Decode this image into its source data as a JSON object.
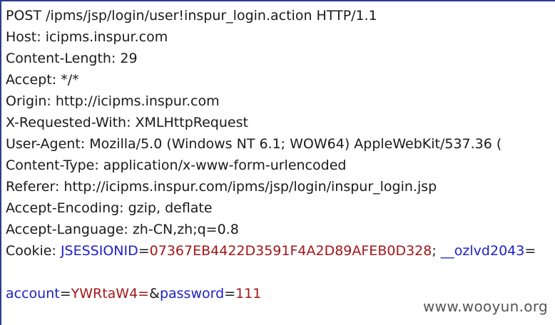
{
  "request": {
    "request_line": "POST /ipms/jsp/login/user!inspur_login.action HTTP/1.1",
    "headers": [
      "Host: icipms.inspur.com",
      "Content-Length: 29",
      "Accept: */*",
      "Origin: http://icipms.inspur.com",
      "X-Requested-With: XMLHttpRequest",
      "User-Agent: Mozilla/5.0 (Windows NT 6.1; WOW64) AppleWebKit/537.36 (",
      "Content-Type: application/x-www-form-urlencoded",
      "Referer: http://icipms.inspur.com/ipms/jsp/login/inspur_login.jsp",
      "Accept-Encoding: gzip, deflate",
      "Accept-Language: zh-CN,zh;q=0.8"
    ],
    "cookie": {
      "label": "Cookie: ",
      "name1": "JSESSIONID",
      "eq": "=",
      "value1": "07367EB4422D3591F4A2D89AFEB0D328",
      "sep": "; ",
      "name2": "__ozlvd2043",
      "tail": "="
    },
    "body": {
      "key1": "account",
      "eq": "=",
      "val1": "YWRtaW4=",
      "amp": "&",
      "key2": "password",
      "val2": "111"
    }
  },
  "watermark": "www.wooyun.org",
  "colors": {
    "key": "#1d20c8",
    "value": "#a3161a",
    "text": "#1a1a1a",
    "border": "#2b3d8f"
  }
}
